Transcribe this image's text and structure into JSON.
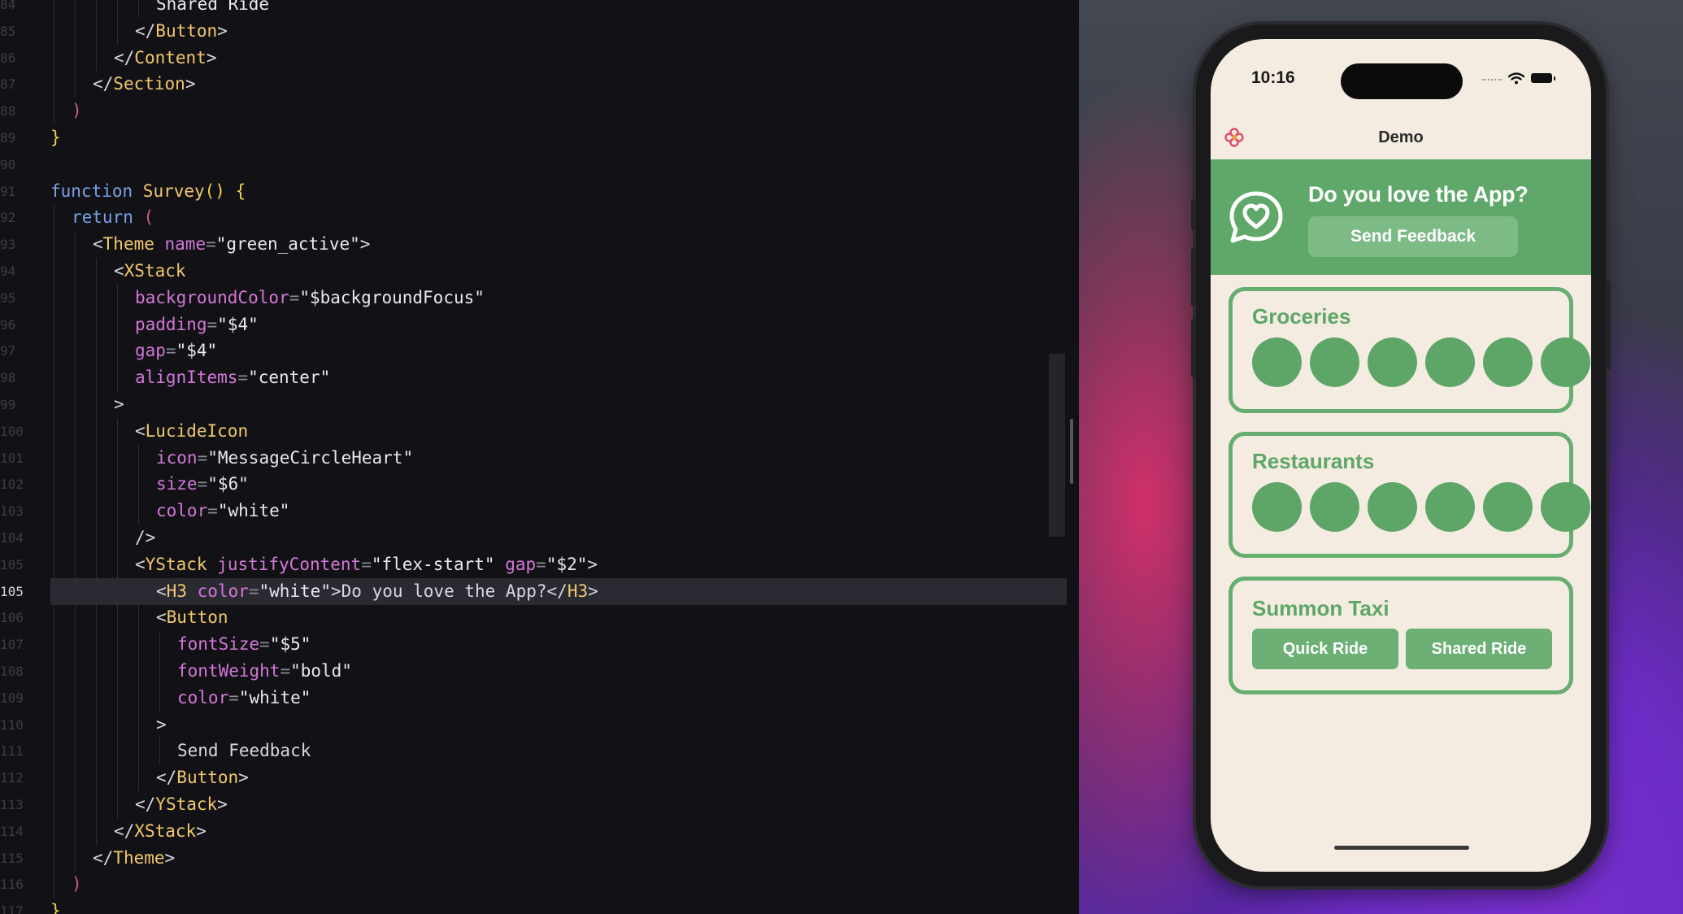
{
  "editor": {
    "lines": [
      {
        "n": "84",
        "indent": 5,
        "tokens": [
          [
            "t-str",
            "Shared Ride"
          ]
        ]
      },
      {
        "n": "85",
        "indent": 4,
        "tokens": [
          [
            "t-punc",
            "</"
          ],
          [
            "t-tag",
            "Button"
          ],
          [
            "t-punc",
            ">"
          ]
        ]
      },
      {
        "n": "86",
        "indent": 3,
        "tokens": [
          [
            "t-punc",
            "</"
          ],
          [
            "t-tag",
            "Content"
          ],
          [
            "t-punc",
            ">"
          ]
        ]
      },
      {
        "n": "87",
        "indent": 2,
        "tokens": [
          [
            "t-punc",
            "</"
          ],
          [
            "t-tag",
            "Section"
          ],
          [
            "t-punc",
            ">"
          ]
        ]
      },
      {
        "n": "88",
        "indent": 1,
        "tokens": [
          [
            "t-paren",
            ")"
          ]
        ]
      },
      {
        "n": "89",
        "indent": 0,
        "tokens": [
          [
            "t-brace",
            "}"
          ]
        ]
      },
      {
        "n": "90",
        "indent": 0,
        "tokens": []
      },
      {
        "n": "91",
        "indent": 0,
        "tokens": [
          [
            "t-kw",
            "function "
          ],
          [
            "t-fn",
            "Survey"
          ],
          [
            "t-brace",
            "() {"
          ]
        ]
      },
      {
        "n": "92",
        "indent": 1,
        "tokens": [
          [
            "t-kw",
            "return "
          ],
          [
            "t-paren",
            "("
          ]
        ]
      },
      {
        "n": "93",
        "indent": 2,
        "tokens": [
          [
            "t-punc",
            "<"
          ],
          [
            "t-tag",
            "Theme "
          ],
          [
            "t-attr",
            "name"
          ],
          [
            "t-eq",
            "="
          ],
          [
            "t-str",
            "\"green_active\""
          ],
          [
            "t-punc",
            ">"
          ]
        ]
      },
      {
        "n": "94",
        "indent": 3,
        "tokens": [
          [
            "t-punc",
            "<"
          ],
          [
            "t-tag",
            "XStack"
          ]
        ]
      },
      {
        "n": "95",
        "indent": 4,
        "tokens": [
          [
            "t-attr",
            "backgroundColor"
          ],
          [
            "t-eq",
            "="
          ],
          [
            "t-str",
            "\"$backgroundFocus\""
          ]
        ]
      },
      {
        "n": "96",
        "indent": 4,
        "tokens": [
          [
            "t-attr",
            "padding"
          ],
          [
            "t-eq",
            "="
          ],
          [
            "t-str",
            "\"$4\""
          ]
        ]
      },
      {
        "n": "97",
        "indent": 4,
        "tokens": [
          [
            "t-attr",
            "gap"
          ],
          [
            "t-eq",
            "="
          ],
          [
            "t-str",
            "\"$4\""
          ]
        ]
      },
      {
        "n": "98",
        "indent": 4,
        "tokens": [
          [
            "t-attr",
            "alignItems"
          ],
          [
            "t-eq",
            "="
          ],
          [
            "t-str",
            "\"center\""
          ]
        ]
      },
      {
        "n": "99",
        "indent": 3,
        "tokens": [
          [
            "t-punc",
            ">"
          ]
        ]
      },
      {
        "n": "100",
        "indent": 4,
        "tokens": [
          [
            "t-punc",
            "<"
          ],
          [
            "t-tag",
            "LucideIcon"
          ]
        ]
      },
      {
        "n": "101",
        "indent": 5,
        "tokens": [
          [
            "t-attr",
            "icon"
          ],
          [
            "t-eq",
            "="
          ],
          [
            "t-str",
            "\"MessageCircleHeart\""
          ]
        ]
      },
      {
        "n": "102",
        "indent": 5,
        "tokens": [
          [
            "t-attr",
            "size"
          ],
          [
            "t-eq",
            "="
          ],
          [
            "t-str",
            "\"$6\""
          ]
        ]
      },
      {
        "n": "103",
        "indent": 5,
        "tokens": [
          [
            "t-attr",
            "color"
          ],
          [
            "t-eq",
            "="
          ],
          [
            "t-str",
            "\"white\""
          ]
        ]
      },
      {
        "n": "104",
        "indent": 4,
        "tokens": [
          [
            "t-punc",
            "/>"
          ]
        ]
      },
      {
        "n": "105",
        "indent": 4,
        "tokens": [
          [
            "t-punc",
            "<"
          ],
          [
            "t-tag",
            "YStack "
          ],
          [
            "t-attr",
            "justifyContent"
          ],
          [
            "t-eq",
            "="
          ],
          [
            "t-str",
            "\"flex-start\" "
          ],
          [
            "t-attr",
            "gap"
          ],
          [
            "t-eq",
            "="
          ],
          [
            "t-str",
            "\"$2\""
          ],
          [
            "t-punc",
            ">"
          ]
        ]
      },
      {
        "n": "105",
        "indent": 5,
        "active": true,
        "tokens": [
          [
            "t-punc",
            "<"
          ],
          [
            "t-tag",
            "H3 "
          ],
          [
            "t-attr",
            "color"
          ],
          [
            "t-eq",
            "="
          ],
          [
            "t-str",
            "\"white\""
          ],
          [
            "t-punc",
            ">"
          ],
          [
            "t-text",
            "Do you love the App?"
          ],
          [
            "t-punc",
            "</"
          ],
          [
            "t-tag",
            "H3"
          ],
          [
            "t-punc",
            ">"
          ]
        ]
      },
      {
        "n": "106",
        "indent": 5,
        "tokens": [
          [
            "t-punc",
            "<"
          ],
          [
            "t-tag",
            "Button"
          ]
        ]
      },
      {
        "n": "107",
        "indent": 6,
        "tokens": [
          [
            "t-attr",
            "fontSize"
          ],
          [
            "t-eq",
            "="
          ],
          [
            "t-str",
            "\"$5\""
          ]
        ]
      },
      {
        "n": "108",
        "indent": 6,
        "tokens": [
          [
            "t-attr",
            "fontWeight"
          ],
          [
            "t-eq",
            "="
          ],
          [
            "t-str",
            "\"bold\""
          ]
        ]
      },
      {
        "n": "109",
        "indent": 6,
        "tokens": [
          [
            "t-attr",
            "color"
          ],
          [
            "t-eq",
            "="
          ],
          [
            "t-str",
            "\"white\""
          ]
        ]
      },
      {
        "n": "110",
        "indent": 5,
        "tokens": [
          [
            "t-punc",
            ">"
          ]
        ]
      },
      {
        "n": "111",
        "indent": 6,
        "tokens": [
          [
            "t-text",
            "Send Feedback"
          ]
        ]
      },
      {
        "n": "112",
        "indent": 5,
        "tokens": [
          [
            "t-punc",
            "</"
          ],
          [
            "t-tag",
            "Button"
          ],
          [
            "t-punc",
            ">"
          ]
        ]
      },
      {
        "n": "113",
        "indent": 4,
        "tokens": [
          [
            "t-punc",
            "</"
          ],
          [
            "t-tag",
            "YStack"
          ],
          [
            "t-punc",
            ">"
          ]
        ]
      },
      {
        "n": "114",
        "indent": 3,
        "tokens": [
          [
            "t-punc",
            "</"
          ],
          [
            "t-tag",
            "XStack"
          ],
          [
            "t-punc",
            ">"
          ]
        ]
      },
      {
        "n": "115",
        "indent": 2,
        "tokens": [
          [
            "t-punc",
            "</"
          ],
          [
            "t-tag",
            "Theme"
          ],
          [
            "t-punc",
            ">"
          ]
        ]
      },
      {
        "n": "116",
        "indent": 1,
        "tokens": [
          [
            "t-paren",
            ")"
          ]
        ]
      },
      {
        "n": "117",
        "indent": 0,
        "tokens": [
          [
            "t-brace",
            "}"
          ]
        ]
      }
    ]
  },
  "phone": {
    "status_time": "10:16",
    "nav_title": "Demo",
    "feedback": {
      "title": "Do you love the App?",
      "button_label": "Send Feedback",
      "icon": "message-circle-heart-icon"
    },
    "cards": {
      "groceries": {
        "title": "Groceries",
        "dot_count": 6
      },
      "restaurants": {
        "title": "Restaurants",
        "dot_count": 6
      },
      "taxi": {
        "title": "Summon Taxi",
        "quick_ride": "Quick Ride",
        "shared_ride": "Shared Ride"
      }
    },
    "colors": {
      "accent_green": "#5fa86a",
      "button_green": "#7dbb86",
      "screen_bg": "#f4ece0"
    }
  }
}
